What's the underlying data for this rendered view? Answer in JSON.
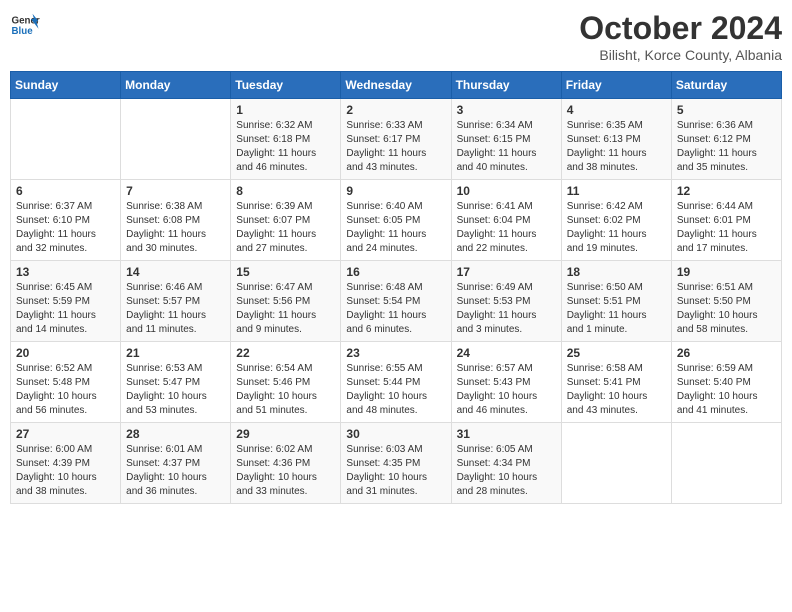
{
  "logo": {
    "general": "General",
    "blue": "Blue"
  },
  "title": "October 2024",
  "subtitle": "Bilisht, Korce County, Albania",
  "days_of_week": [
    "Sunday",
    "Monday",
    "Tuesday",
    "Wednesday",
    "Thursday",
    "Friday",
    "Saturday"
  ],
  "weeks": [
    [
      {
        "day": "",
        "sunrise": "",
        "sunset": "",
        "daylight": ""
      },
      {
        "day": "",
        "sunrise": "",
        "sunset": "",
        "daylight": ""
      },
      {
        "day": "1",
        "sunrise": "Sunrise: 6:32 AM",
        "sunset": "Sunset: 6:18 PM",
        "daylight": "Daylight: 11 hours and 46 minutes."
      },
      {
        "day": "2",
        "sunrise": "Sunrise: 6:33 AM",
        "sunset": "Sunset: 6:17 PM",
        "daylight": "Daylight: 11 hours and 43 minutes."
      },
      {
        "day": "3",
        "sunrise": "Sunrise: 6:34 AM",
        "sunset": "Sunset: 6:15 PM",
        "daylight": "Daylight: 11 hours and 40 minutes."
      },
      {
        "day": "4",
        "sunrise": "Sunrise: 6:35 AM",
        "sunset": "Sunset: 6:13 PM",
        "daylight": "Daylight: 11 hours and 38 minutes."
      },
      {
        "day": "5",
        "sunrise": "Sunrise: 6:36 AM",
        "sunset": "Sunset: 6:12 PM",
        "daylight": "Daylight: 11 hours and 35 minutes."
      }
    ],
    [
      {
        "day": "6",
        "sunrise": "Sunrise: 6:37 AM",
        "sunset": "Sunset: 6:10 PM",
        "daylight": "Daylight: 11 hours and 32 minutes."
      },
      {
        "day": "7",
        "sunrise": "Sunrise: 6:38 AM",
        "sunset": "Sunset: 6:08 PM",
        "daylight": "Daylight: 11 hours and 30 minutes."
      },
      {
        "day": "8",
        "sunrise": "Sunrise: 6:39 AM",
        "sunset": "Sunset: 6:07 PM",
        "daylight": "Daylight: 11 hours and 27 minutes."
      },
      {
        "day": "9",
        "sunrise": "Sunrise: 6:40 AM",
        "sunset": "Sunset: 6:05 PM",
        "daylight": "Daylight: 11 hours and 24 minutes."
      },
      {
        "day": "10",
        "sunrise": "Sunrise: 6:41 AM",
        "sunset": "Sunset: 6:04 PM",
        "daylight": "Daylight: 11 hours and 22 minutes."
      },
      {
        "day": "11",
        "sunrise": "Sunrise: 6:42 AM",
        "sunset": "Sunset: 6:02 PM",
        "daylight": "Daylight: 11 hours and 19 minutes."
      },
      {
        "day": "12",
        "sunrise": "Sunrise: 6:44 AM",
        "sunset": "Sunset: 6:01 PM",
        "daylight": "Daylight: 11 hours and 17 minutes."
      }
    ],
    [
      {
        "day": "13",
        "sunrise": "Sunrise: 6:45 AM",
        "sunset": "Sunset: 5:59 PM",
        "daylight": "Daylight: 11 hours and 14 minutes."
      },
      {
        "day": "14",
        "sunrise": "Sunrise: 6:46 AM",
        "sunset": "Sunset: 5:57 PM",
        "daylight": "Daylight: 11 hours and 11 minutes."
      },
      {
        "day": "15",
        "sunrise": "Sunrise: 6:47 AM",
        "sunset": "Sunset: 5:56 PM",
        "daylight": "Daylight: 11 hours and 9 minutes."
      },
      {
        "day": "16",
        "sunrise": "Sunrise: 6:48 AM",
        "sunset": "Sunset: 5:54 PM",
        "daylight": "Daylight: 11 hours and 6 minutes."
      },
      {
        "day": "17",
        "sunrise": "Sunrise: 6:49 AM",
        "sunset": "Sunset: 5:53 PM",
        "daylight": "Daylight: 11 hours and 3 minutes."
      },
      {
        "day": "18",
        "sunrise": "Sunrise: 6:50 AM",
        "sunset": "Sunset: 5:51 PM",
        "daylight": "Daylight: 11 hours and 1 minute."
      },
      {
        "day": "19",
        "sunrise": "Sunrise: 6:51 AM",
        "sunset": "Sunset: 5:50 PM",
        "daylight": "Daylight: 10 hours and 58 minutes."
      }
    ],
    [
      {
        "day": "20",
        "sunrise": "Sunrise: 6:52 AM",
        "sunset": "Sunset: 5:48 PM",
        "daylight": "Daylight: 10 hours and 56 minutes."
      },
      {
        "day": "21",
        "sunrise": "Sunrise: 6:53 AM",
        "sunset": "Sunset: 5:47 PM",
        "daylight": "Daylight: 10 hours and 53 minutes."
      },
      {
        "day": "22",
        "sunrise": "Sunrise: 6:54 AM",
        "sunset": "Sunset: 5:46 PM",
        "daylight": "Daylight: 10 hours and 51 minutes."
      },
      {
        "day": "23",
        "sunrise": "Sunrise: 6:55 AM",
        "sunset": "Sunset: 5:44 PM",
        "daylight": "Daylight: 10 hours and 48 minutes."
      },
      {
        "day": "24",
        "sunrise": "Sunrise: 6:57 AM",
        "sunset": "Sunset: 5:43 PM",
        "daylight": "Daylight: 10 hours and 46 minutes."
      },
      {
        "day": "25",
        "sunrise": "Sunrise: 6:58 AM",
        "sunset": "Sunset: 5:41 PM",
        "daylight": "Daylight: 10 hours and 43 minutes."
      },
      {
        "day": "26",
        "sunrise": "Sunrise: 6:59 AM",
        "sunset": "Sunset: 5:40 PM",
        "daylight": "Daylight: 10 hours and 41 minutes."
      }
    ],
    [
      {
        "day": "27",
        "sunrise": "Sunrise: 6:00 AM",
        "sunset": "Sunset: 4:39 PM",
        "daylight": "Daylight: 10 hours and 38 minutes."
      },
      {
        "day": "28",
        "sunrise": "Sunrise: 6:01 AM",
        "sunset": "Sunset: 4:37 PM",
        "daylight": "Daylight: 10 hours and 36 minutes."
      },
      {
        "day": "29",
        "sunrise": "Sunrise: 6:02 AM",
        "sunset": "Sunset: 4:36 PM",
        "daylight": "Daylight: 10 hours and 33 minutes."
      },
      {
        "day": "30",
        "sunrise": "Sunrise: 6:03 AM",
        "sunset": "Sunset: 4:35 PM",
        "daylight": "Daylight: 10 hours and 31 minutes."
      },
      {
        "day": "31",
        "sunrise": "Sunrise: 6:05 AM",
        "sunset": "Sunset: 4:34 PM",
        "daylight": "Daylight: 10 hours and 28 minutes."
      },
      {
        "day": "",
        "sunrise": "",
        "sunset": "",
        "daylight": ""
      },
      {
        "day": "",
        "sunrise": "",
        "sunset": "",
        "daylight": ""
      }
    ]
  ]
}
